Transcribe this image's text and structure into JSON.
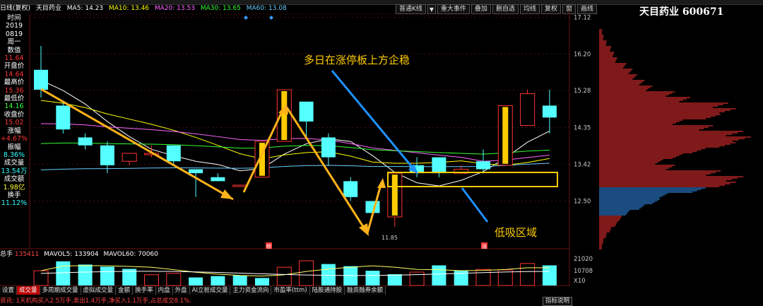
{
  "topbar": {
    "placeholder_count": 20
  },
  "ma_bar": {
    "title": "日线(复权)",
    "name": "天目药业",
    "ma5_label": "MA5: 14.23",
    "ma10_label": "MA10: 13.46",
    "ma20_label": "MA20: 13.53",
    "ma30_label": "MA30: 13.65",
    "ma60_label": "MA60: 13.08",
    "colors": {
      "ma5": "#ffffff",
      "ma10": "#ffff00",
      "ma20": "#ff66ff",
      "ma30": "#33ff33",
      "ma60": "#66ccff"
    }
  },
  "toolbar": {
    "buttons": [
      "普通K线",
      "重大事件",
      "叠加",
      "删自选",
      "均线",
      "复权",
      "窗",
      "画线"
    ]
  },
  "stock_title": "天目药业 600671",
  "info_panel": {
    "time_label": "时间",
    "year": "2019",
    "date": "0819",
    "weekday_label": "周一",
    "weekday_value": "数值",
    "weekday_value2": "11.64",
    "open_label": "开盘价",
    "open_value": "14.64",
    "high_label": "最高价",
    "high_value": "15.36",
    "low_label": "最低价",
    "low_value": "14.16",
    "close_label": "收盘价",
    "close_value": "15.02",
    "change_label": "涨幅",
    "change_value": "+4.67%",
    "amp_label": "振幅",
    "amp_value": "8.36%",
    "vol_label": "成交量",
    "vol_value": "13.54万",
    "amount_label": "成交额",
    "amount_value": "1.98亿",
    "turnover_label": "换手",
    "turnover_value": "11.12%"
  },
  "annotations": {
    "top_text": "多日在涨停板上方企稳",
    "low_text": "低吸区域",
    "low_price": "11.85",
    "marker_1": "榜",
    "marker_2": "涨"
  },
  "price_axis": {
    "ticks": [
      "17.12",
      "16.20",
      "15.28",
      "14.35",
      "13.42",
      "12.50"
    ]
  },
  "chart_data": {
    "type": "candlestick",
    "ylim": [
      11.3,
      17.2
    ],
    "candles": [
      {
        "o": 15.8,
        "c": 15.3,
        "h": 16.4,
        "l": 15.1
      },
      {
        "o": 14.9,
        "c": 14.3,
        "h": 15.0,
        "l": 14.2
      },
      {
        "o": 14.1,
        "c": 13.9,
        "h": 14.2,
        "l": 13.8
      },
      {
        "o": 13.9,
        "c": 13.4,
        "h": 14.0,
        "l": 13.2
      },
      {
        "o": 13.5,
        "c": 13.7,
        "h": 13.7,
        "l": 13.4
      },
      {
        "o": 13.7,
        "c": 13.7,
        "h": 13.9,
        "l": 13.6
      },
      {
        "o": 13.9,
        "c": 13.5,
        "h": 13.9,
        "l": 13.4
      },
      {
        "o": 13.3,
        "c": 13.2,
        "h": 13.3,
        "l": 12.6
      },
      {
        "o": 13.1,
        "c": 13.0,
        "h": 13.2,
        "l": 13.0
      },
      {
        "o": 12.9,
        "c": 12.9,
        "h": 12.9,
        "l": 12.9
      },
      {
        "o": 13.1,
        "c": 14.0,
        "h": 14.0,
        "l": 13.1
      },
      {
        "o": 14.0,
        "c": 15.3,
        "h": 15.3,
        "l": 14.0
      },
      {
        "o": 15.0,
        "c": 14.5,
        "h": 15.0,
        "l": 14.1
      },
      {
        "o": 14.1,
        "c": 13.6,
        "h": 14.2,
        "l": 13.4
      },
      {
        "o": 13.0,
        "c": 12.6,
        "h": 13.1,
        "l": 12.5
      },
      {
        "o": 12.5,
        "c": 12.2,
        "h": 12.5,
        "l": 12.2
      },
      {
        "o": 12.1,
        "c": 13.2,
        "h": 13.2,
        "l": 11.85
      },
      {
        "o": 13.4,
        "c": 13.2,
        "h": 13.6,
        "l": 13.1
      },
      {
        "o": 13.6,
        "c": 13.2,
        "h": 13.6,
        "l": 13.1
      },
      {
        "o": 13.2,
        "c": 13.3,
        "h": 13.4,
        "l": 13.2
      },
      {
        "o": 13.5,
        "c": 13.3,
        "h": 13.8,
        "l": 13.2
      },
      {
        "o": 13.4,
        "c": 14.9,
        "h": 14.9,
        "l": 13.4
      },
      {
        "o": 14.4,
        "c": 15.2,
        "h": 15.3,
        "l": 14.4
      },
      {
        "o": 14.9,
        "c": 14.6,
        "h": 15.3,
        "l": 14.2
      }
    ],
    "limit_up_indices": [
      10,
      11,
      16,
      21
    ],
    "volume_bar": {
      "label": "总手",
      "value": "135411",
      "mavol5_label": "MAVOL5:",
      "mavol5": "133904",
      "mavol60_label": "MAVOL60:",
      "mavol60": "70060"
    },
    "volume_axis": [
      "21020",
      "10708",
      "X10"
    ],
    "volumes": [
      {
        "v": 0.55,
        "up": true
      },
      {
        "v": 0.9,
        "up": false
      },
      {
        "v": 0.78,
        "up": false
      },
      {
        "v": 0.7,
        "up": false
      },
      {
        "v": 0.62,
        "up": false
      },
      {
        "v": 0.4,
        "up": true
      },
      {
        "v": 0.45,
        "up": true
      },
      {
        "v": 0.3,
        "up": false
      },
      {
        "v": 0.35,
        "up": false
      },
      {
        "v": 0.38,
        "up": false
      },
      {
        "v": 0.28,
        "up": false
      },
      {
        "v": 0.68,
        "up": true
      },
      {
        "v": 0.92,
        "up": true
      },
      {
        "v": 0.8,
        "up": false
      },
      {
        "v": 0.72,
        "up": false
      },
      {
        "v": 0.55,
        "up": false
      },
      {
        "v": 0.42,
        "up": false
      },
      {
        "v": 0.5,
        "up": true
      },
      {
        "v": 0.75,
        "up": false
      },
      {
        "v": 0.55,
        "up": false
      },
      {
        "v": 0.6,
        "up": true
      },
      {
        "v": 0.58,
        "up": true
      },
      {
        "v": 0.82,
        "up": true
      },
      {
        "v": 0.75,
        "up": false
      }
    ],
    "chip_profile": [
      0.02,
      0.03,
      0.05,
      0.08,
      0.1,
      0.12,
      0.18,
      0.22,
      0.25,
      0.3,
      0.35,
      0.5,
      0.6,
      0.85,
      0.9,
      0.8,
      0.55,
      0.75,
      0.95,
      1.0,
      0.9,
      0.7,
      0.55,
      0.42,
      0.5,
      0.8,
      0.95,
      0.9,
      0.7,
      0.45,
      0.4,
      0.3,
      0.2,
      0.15,
      0.12,
      0.08,
      0.05,
      0.03,
      0.02
    ]
  },
  "tabs": [
    "设置",
    "成交量",
    "多周期成交量",
    "虚拟成交量",
    "金额",
    "换手率",
    "内盘",
    "外盘",
    "AI立桩成交量",
    "主力资金流向",
    "市盈率(ttm)",
    "陆股通持股",
    "融资融券余额"
  ],
  "active_tab": 1,
  "ticker": "资讯: 1天机构买入2.5万手,卖出1.4万手,净买入1.1万手,占总成交8.1%.",
  "legend_btn": "指标说明",
  "colors": {
    "bg": "#000000",
    "up_edge": "#ff3333",
    "down_fill": "#54ffff",
    "limit_fill": "#ffcc00",
    "arrow_orange": "#ffb31a",
    "arrow_blue": "#1e90ff",
    "box": "#ffcc00"
  }
}
